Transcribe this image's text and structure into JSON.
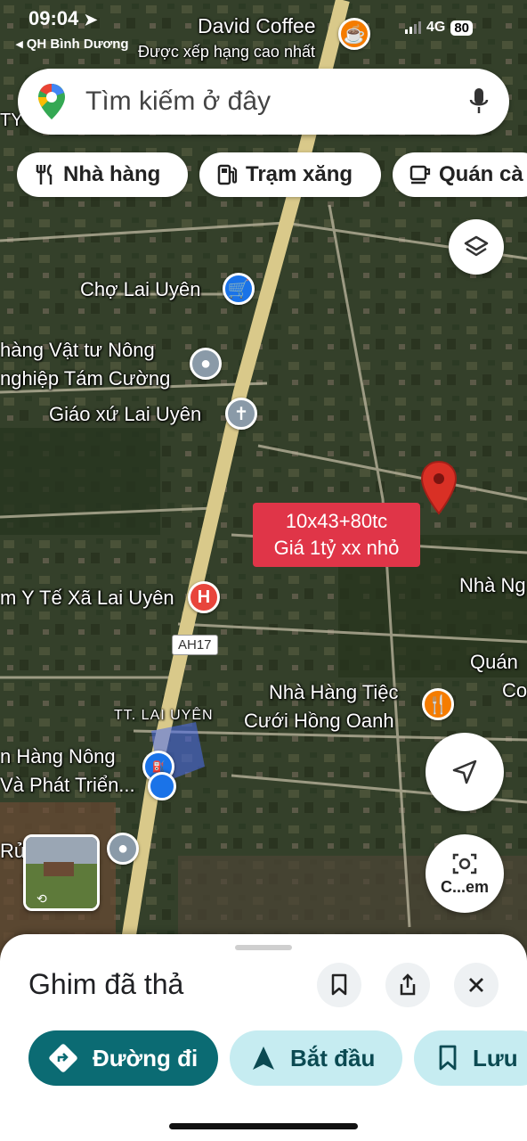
{
  "status_bar": {
    "time": "09:04",
    "back_label": "◂ QH Bình Dương",
    "network": "4G",
    "battery": "80"
  },
  "search": {
    "placeholder": "Tìm kiếm ở đây"
  },
  "chips": [
    {
      "label": "Nhà hàng",
      "icon": "fork-knife-icon"
    },
    {
      "label": "Trạm xăng",
      "icon": "gas-station-icon"
    },
    {
      "label": "Quán cà",
      "icon": "coffee-cup-icon"
    }
  ],
  "map": {
    "pois": {
      "david_coffee": "David Coffee",
      "david_coffee_sub": "Được xếp hạng cao nhất",
      "cho_lai_uyen": "Chợ Lai Uyên",
      "vat_tu_line1": "hàng Vật tư Nông",
      "vat_tu_line2": "nghiệp Tám Cường",
      "giao_xu": "Giáo xứ Lai Uyên",
      "y_te": "m Y Tế Xã Lai Uyên",
      "nha_ng": "Nhà Ng",
      "quan": "Quán",
      "co": "Co",
      "nha_hang_line1": "Nhà Hàng Tiệc",
      "nha_hang_line2": "Cưới Hồng Oanh",
      "nong_line1": "n Hàng Nông",
      "nong_line2": "Và Phát Triển...",
      "ru": "Rủ",
      "ty": "TY",
      "tt_lai_uyen": "TT. LAI UYÊN",
      "road_shield": "AH17"
    },
    "annotation": {
      "line1": "10x43+80tc",
      "line2": "Giá 1tỷ xx nhỏ"
    },
    "camera_label": "C...em",
    "colors": {
      "pin": "#d93025",
      "annotation_bg": "#e03548",
      "road": "#d9c98a",
      "location": "#1a73e8"
    }
  },
  "sheet": {
    "title": "Ghim đã thả",
    "actions": {
      "directions": "Đường đi",
      "start": "Bắt đầu",
      "save": "Lưu"
    }
  }
}
